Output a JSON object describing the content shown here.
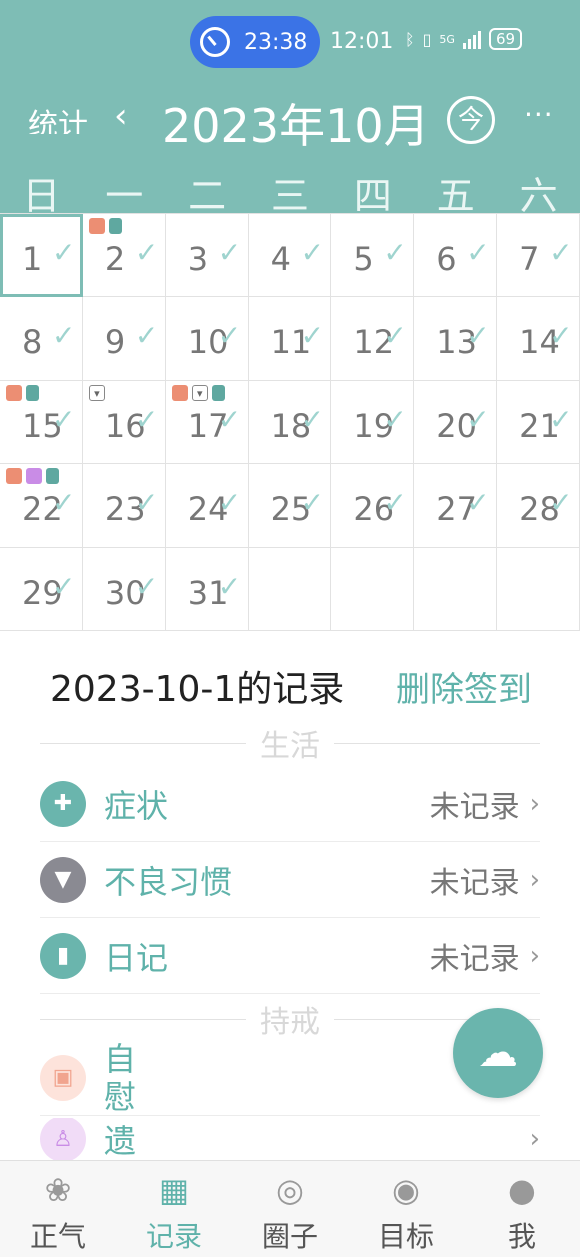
{
  "status_bar": {
    "timer_pill": "23:38",
    "clock": "12:01",
    "battery": "69",
    "network": "5G"
  },
  "header": {
    "stat_label": "统计",
    "prev_icon": "chevron-left-icon",
    "month_title": "2023年10月",
    "today_label": "今",
    "more": "···"
  },
  "weekdays": [
    "日",
    "一",
    "二",
    "三",
    "四",
    "五",
    "六"
  ],
  "calendar": {
    "accent": "#7ebdb5",
    "selected_day": "1",
    "days": [
      {
        "d": "1"
      },
      {
        "d": "2",
        "check": ""
      },
      {
        "d": "3"
      },
      {
        "d": "4"
      },
      {
        "d": "5"
      },
      {
        "d": "6"
      },
      {
        "d": "7"
      },
      {
        "d": "8"
      },
      {
        "d": "9"
      },
      {
        "d": "10"
      },
      {
        "d": "11"
      },
      {
        "d": "12"
      },
      {
        "d": "13"
      },
      {
        "d": "14"
      },
      {
        "d": "15",
        "check": ""
      },
      {
        "d": "16"
      },
      {
        "d": "17",
        "check": ""
      },
      {
        "d": "18"
      },
      {
        "d": "19"
      },
      {
        "d": "20"
      },
      {
        "d": "21"
      },
      {
        "d": "22",
        "check": ""
      },
      {
        "d": "23"
      },
      {
        "d": "24"
      },
      {
        "d": "25"
      },
      {
        "d": "26"
      },
      {
        "d": "27"
      },
      {
        "d": "28"
      },
      {
        "d": "29"
      },
      {
        "d": "30"
      },
      {
        "d": "31"
      },
      {
        "d": ""
      },
      {
        "d": ""
      },
      {
        "d": ""
      },
      {
        "d": ""
      }
    ],
    "check_mark": "✓"
  },
  "records": {
    "title": "2023-10-1的记录",
    "delete_label": "删除签到",
    "section_life": "生活",
    "rows": [
      {
        "label": "症状",
        "value": "未记录"
      },
      {
        "label": "不良习惯",
        "value": "未记录"
      },
      {
        "label": "日记",
        "value": "未记录"
      }
    ],
    "section_abstain": "持戒",
    "abstain_rows": [
      {
        "label": "自慰"
      },
      {
        "label": "遗"
      }
    ]
  },
  "tabs": [
    {
      "label": "正气",
      "icon": "lotus-icon"
    },
    {
      "label": "记录",
      "icon": "calendar-icon"
    },
    {
      "label": "圈子",
      "icon": "circle-icon"
    },
    {
      "label": "目标",
      "icon": "target-icon"
    },
    {
      "label": "我",
      "icon": "person-icon"
    }
  ]
}
